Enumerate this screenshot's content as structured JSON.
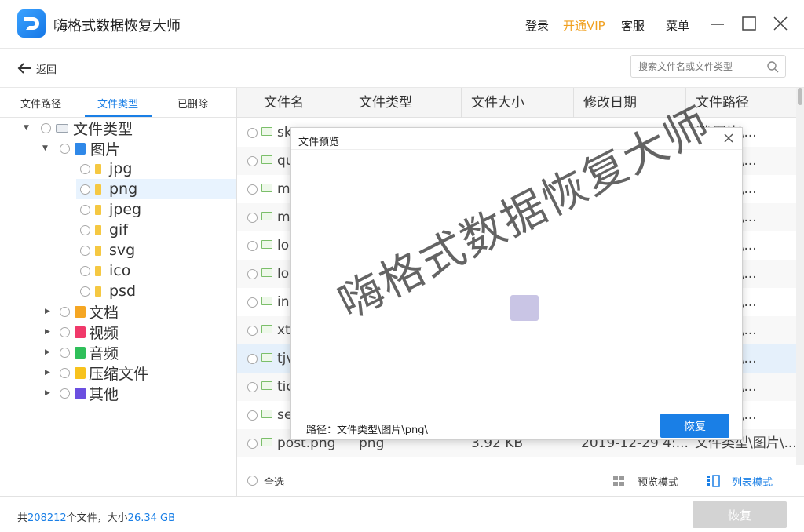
{
  "app": {
    "title": "嗨格式数据恢复大师",
    "top_links": {
      "login": "登录",
      "vip": "开通VIP",
      "service": "客服",
      "menu": "菜单"
    },
    "colors": {
      "accent": "#1a7fe6",
      "vip": "#f0a020"
    }
  },
  "backbar": {
    "back_label": "返回",
    "search_placeholder": "搜索文件名或文件类型"
  },
  "left_tabs": [
    "文件路径",
    "文件类型",
    "已删除"
  ],
  "tree": {
    "root": "文件类型",
    "images": "图片",
    "image_types": [
      "jpg",
      "png",
      "jpeg",
      "gif",
      "svg",
      "ico",
      "psd"
    ],
    "others": [
      "文档",
      "视频",
      "音频",
      "压缩文件",
      "其他"
    ]
  },
  "table": {
    "columns": [
      "文件名",
      "文件类型",
      "文件大小",
      "修改日期",
      "文件路径"
    ],
    "rows": [
      {
        "name": "sk",
        "path": "型\\图片\\..."
      },
      {
        "name": "qu",
        "path": "型\\图片\\..."
      },
      {
        "name": "m",
        "path": "型\\图片\\..."
      },
      {
        "name": "m",
        "path": "型\\图片\\..."
      },
      {
        "name": "lo",
        "path": "型\\图片\\..."
      },
      {
        "name": "lo",
        "path": "型\\图片\\..."
      },
      {
        "name": "in",
        "path": "型\\图片\\..."
      },
      {
        "name": "xt",
        "path": "型\\图片\\..."
      },
      {
        "name": "tjv",
        "path": "型\\图片\\..."
      },
      {
        "name": "tic",
        "path": "型\\图片\\..."
      },
      {
        "name": "se",
        "path": "型\\图片\\..."
      },
      {
        "name": "post.png",
        "type": "png",
        "size": "3.92 KB",
        "date": "2019-12-29 4:...",
        "path": "文件类型\\图片\\..."
      }
    ],
    "select_all": "全选",
    "modes": {
      "preview": "预览模式",
      "list": "列表模式"
    }
  },
  "status": {
    "prefix": "共",
    "file_count": "208212",
    "mid": "个文件，大小",
    "total_size": "26.34 GB",
    "restore_label": "恢复"
  },
  "modal": {
    "title": "文件预览",
    "path_text": "路径：文件类型\\图片\\png\\",
    "restore_label": "恢复"
  },
  "watermark": "嗨格式数据恢复大师"
}
